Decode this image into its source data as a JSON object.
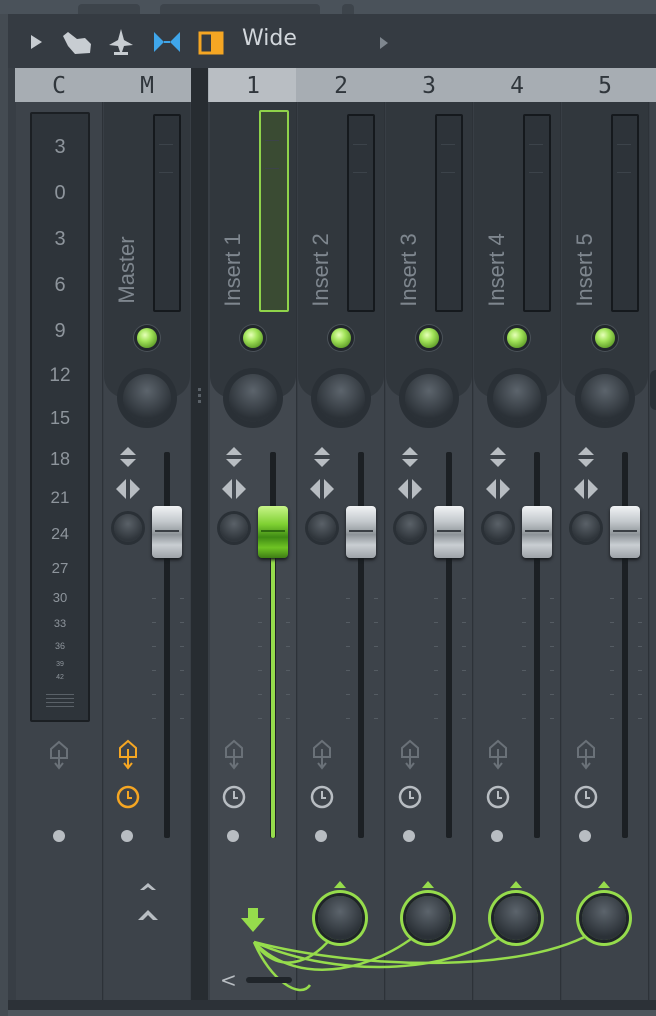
{
  "toolbar": {
    "preset_label": "Wide",
    "icons": [
      "play-arrow-icon",
      "grab-hand-icon",
      "tuner-icon",
      "routing-swap-icon",
      "panel-view-icon",
      "next-arrow-icon"
    ]
  },
  "header": {
    "columns": [
      "C",
      "M",
      "1",
      "2",
      "3",
      "4",
      "5"
    ],
    "selected": "1"
  },
  "scale": {
    "labels": [
      "3",
      "0",
      "3",
      "6",
      "9",
      "12",
      "15",
      "18",
      "21",
      "24",
      "27",
      "30",
      "33",
      "36",
      "39",
      "42"
    ]
  },
  "tracks": [
    {
      "number": "M",
      "name": "Master"
    },
    {
      "number": "1",
      "name": "Insert 1",
      "selected": true
    },
    {
      "number": "2",
      "name": "Insert 2"
    },
    {
      "number": "3",
      "name": "Insert 3"
    },
    {
      "number": "4",
      "name": "Insert 4"
    },
    {
      "number": "5",
      "name": "Insert 5"
    }
  ],
  "footer": {
    "scroll_left_label": "<"
  },
  "colors": {
    "accent_green": "#96dc4c",
    "accent_orange": "#f5a623",
    "panel": "#383e45",
    "header": "#a7adb3"
  }
}
